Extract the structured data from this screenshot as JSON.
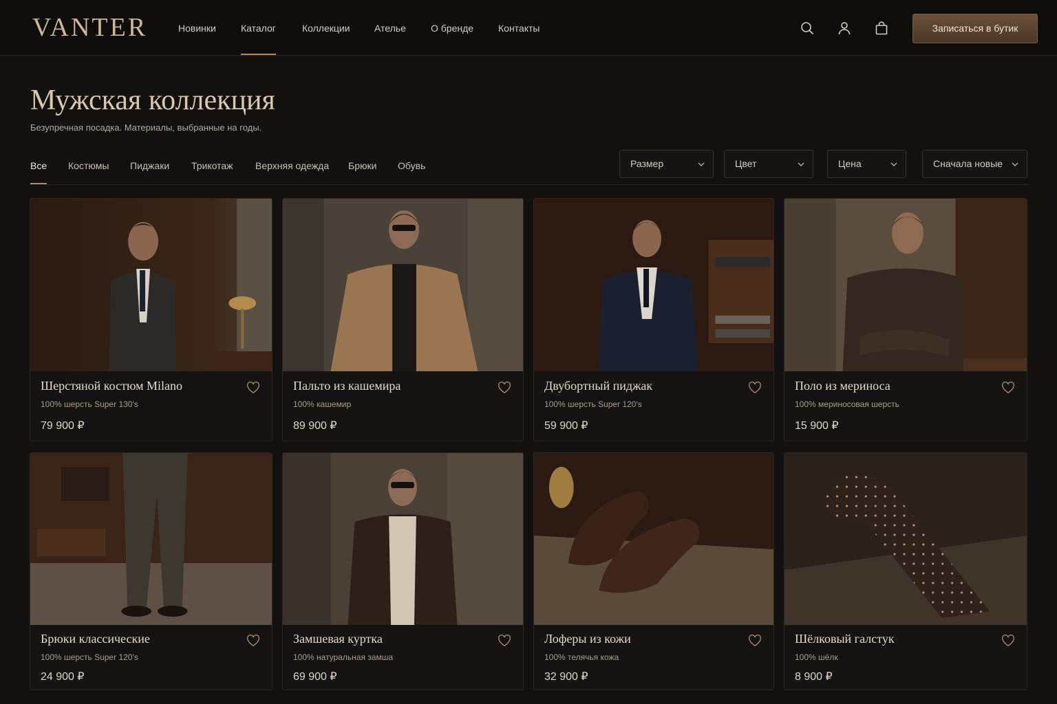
{
  "brand": {
    "logo": "VANTER"
  },
  "nav": {
    "items": [
      {
        "label": "Новинки"
      },
      {
        "label": "Каталог",
        "active": true
      },
      {
        "label": "Коллекции"
      },
      {
        "label": "Ателье"
      },
      {
        "label": "О бренде"
      },
      {
        "label": "Контакты"
      }
    ]
  },
  "header_icons": [
    "search-icon",
    "user-icon",
    "bag-icon"
  ],
  "cta": {
    "label": "Записаться в бутик"
  },
  "page": {
    "title": "Мужская коллекция",
    "subtitle": "Безупречная посадка. Материалы, выбранные на годы."
  },
  "tabs": [
    {
      "label": "Все",
      "active": true
    },
    {
      "label": "Костюмы"
    },
    {
      "label": "Пиджаки"
    },
    {
      "label": "Трикотаж"
    },
    {
      "label": "Верхняя одежда"
    },
    {
      "label": "Брюки"
    },
    {
      "label": "Обувь"
    }
  ],
  "filters": [
    {
      "label": "Размер"
    },
    {
      "label": "Цвет"
    },
    {
      "label": "Цена"
    },
    {
      "label": "Сначала новые"
    }
  ],
  "products": [
    {
      "name": "Шерстяной костюм Milano",
      "material": "100% шерсть Super 130's",
      "price": "79 900 ₽"
    },
    {
      "name": "Пальто из кашемира",
      "material": "100% кашемир",
      "price": "89 900 ₽"
    },
    {
      "name": "Двубортный пиджак",
      "material": "100% шерсть Super 120's",
      "price": "59 900 ₽"
    },
    {
      "name": "Поло из мериноса",
      "material": "100% мериносовая шерсть",
      "price": "15 900 ₽"
    },
    {
      "name": "Брюки классические",
      "material": "100% шерсть Super 120's",
      "price": "24 900 ₽"
    },
    {
      "name": "Замшевая куртка",
      "material": "100% натуральная замша",
      "price": "69 900 ₽"
    },
    {
      "name": "Лоферы из кожи",
      "material": "100% телячья кожа",
      "price": "32 900 ₽"
    },
    {
      "name": "Шёлковый галстук",
      "material": "100% шёлк",
      "price": "8 900 ₽"
    }
  ],
  "colors": {
    "accent": "#b08a62",
    "background": "#121110",
    "cta": "#5a4330"
  }
}
